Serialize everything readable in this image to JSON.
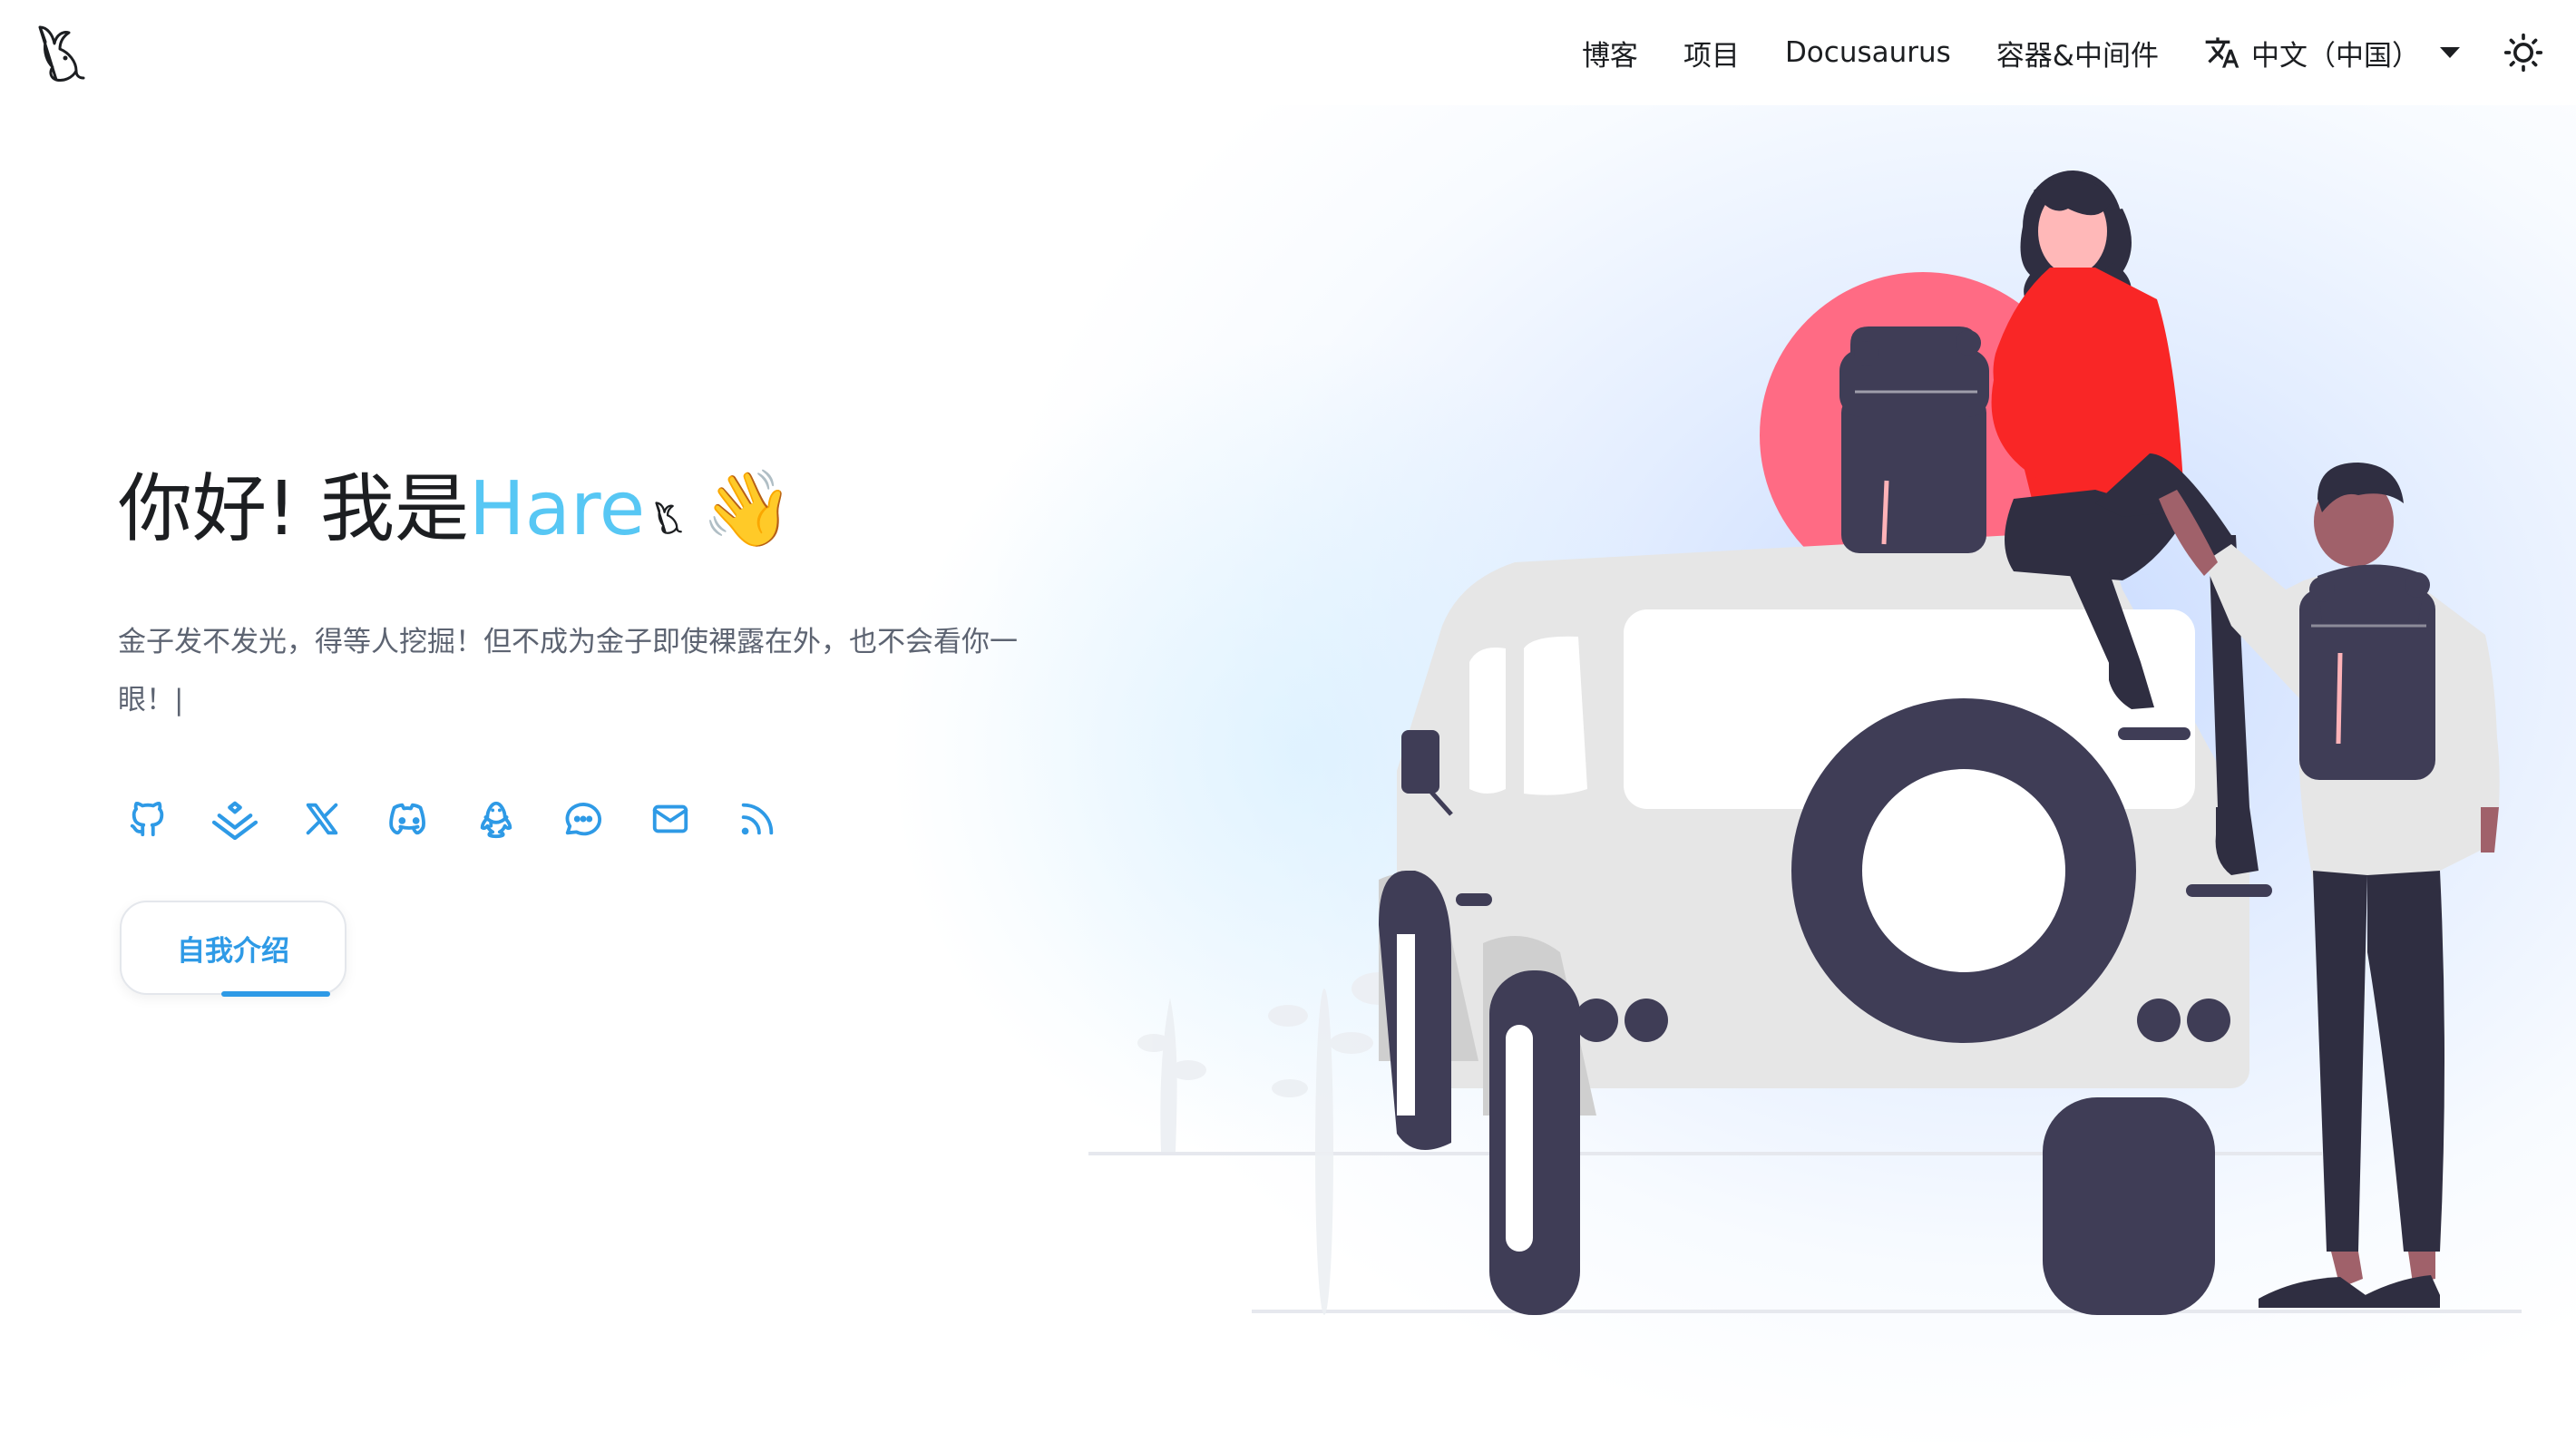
{
  "navbar": {
    "logo_icon": "rabbit-icon",
    "links": [
      "博客",
      "项目",
      "Docusaurus",
      "容器&中间件"
    ],
    "language": "中文（中国）",
    "language_icon": "translate-icon",
    "theme_icon": "sun-icon"
  },
  "hero": {
    "greeting": "你好! 我是",
    "name": "Hare",
    "name_color": "#57c7f4",
    "wave_emoji": "👋",
    "subtitle": "金子发不发光，得等人挖掘！但不成为金子即使裸露在外，也不会看你一眼！|",
    "social_icons": [
      "github-icon",
      "juejin-icon",
      "x-icon",
      "discord-icon",
      "qq-icon",
      "wechat-icon",
      "email-icon",
      "rss-icon"
    ],
    "icon_color": "#2e9ae6",
    "cta_label": "自我介绍"
  },
  "illustration": {
    "description_icon": "travelers-with-jeep-illustration"
  }
}
